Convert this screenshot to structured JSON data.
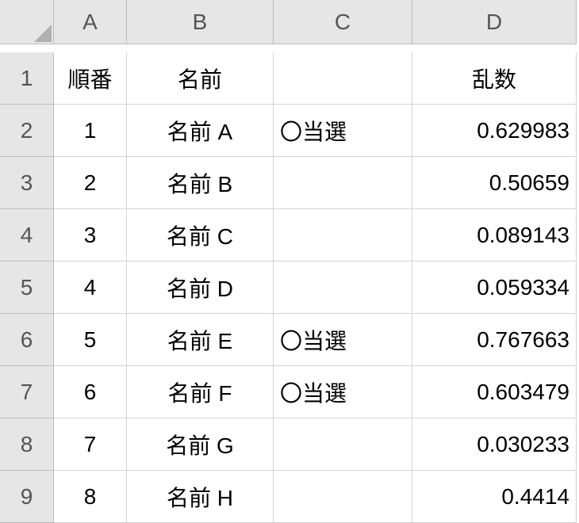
{
  "column_letters": [
    "A",
    "B",
    "C",
    "D"
  ],
  "row_numbers": [
    "1",
    "2",
    "3",
    "4",
    "5",
    "6",
    "7",
    "8",
    "9"
  ],
  "headers": {
    "A": "順番",
    "B": "名前",
    "C": "",
    "D": "乱数"
  },
  "rows": [
    {
      "order": "1",
      "name": "名前 A",
      "status": "〇当選",
      "rand": "0.629983"
    },
    {
      "order": "2",
      "name": "名前 B",
      "status": "",
      "rand": "0.50659"
    },
    {
      "order": "3",
      "name": "名前 C",
      "status": "",
      "rand": "0.089143"
    },
    {
      "order": "4",
      "name": "名前 D",
      "status": "",
      "rand": "0.059334"
    },
    {
      "order": "5",
      "name": "名前 E",
      "status": "〇当選",
      "rand": "0.767663"
    },
    {
      "order": "6",
      "name": "名前 F",
      "status": "〇当選",
      "rand": "0.603479"
    },
    {
      "order": "7",
      "name": "名前 G",
      "status": "",
      "rand": "0.030233"
    },
    {
      "order": "8",
      "name": "名前 H",
      "status": "",
      "rand": "0.4414"
    }
  ]
}
